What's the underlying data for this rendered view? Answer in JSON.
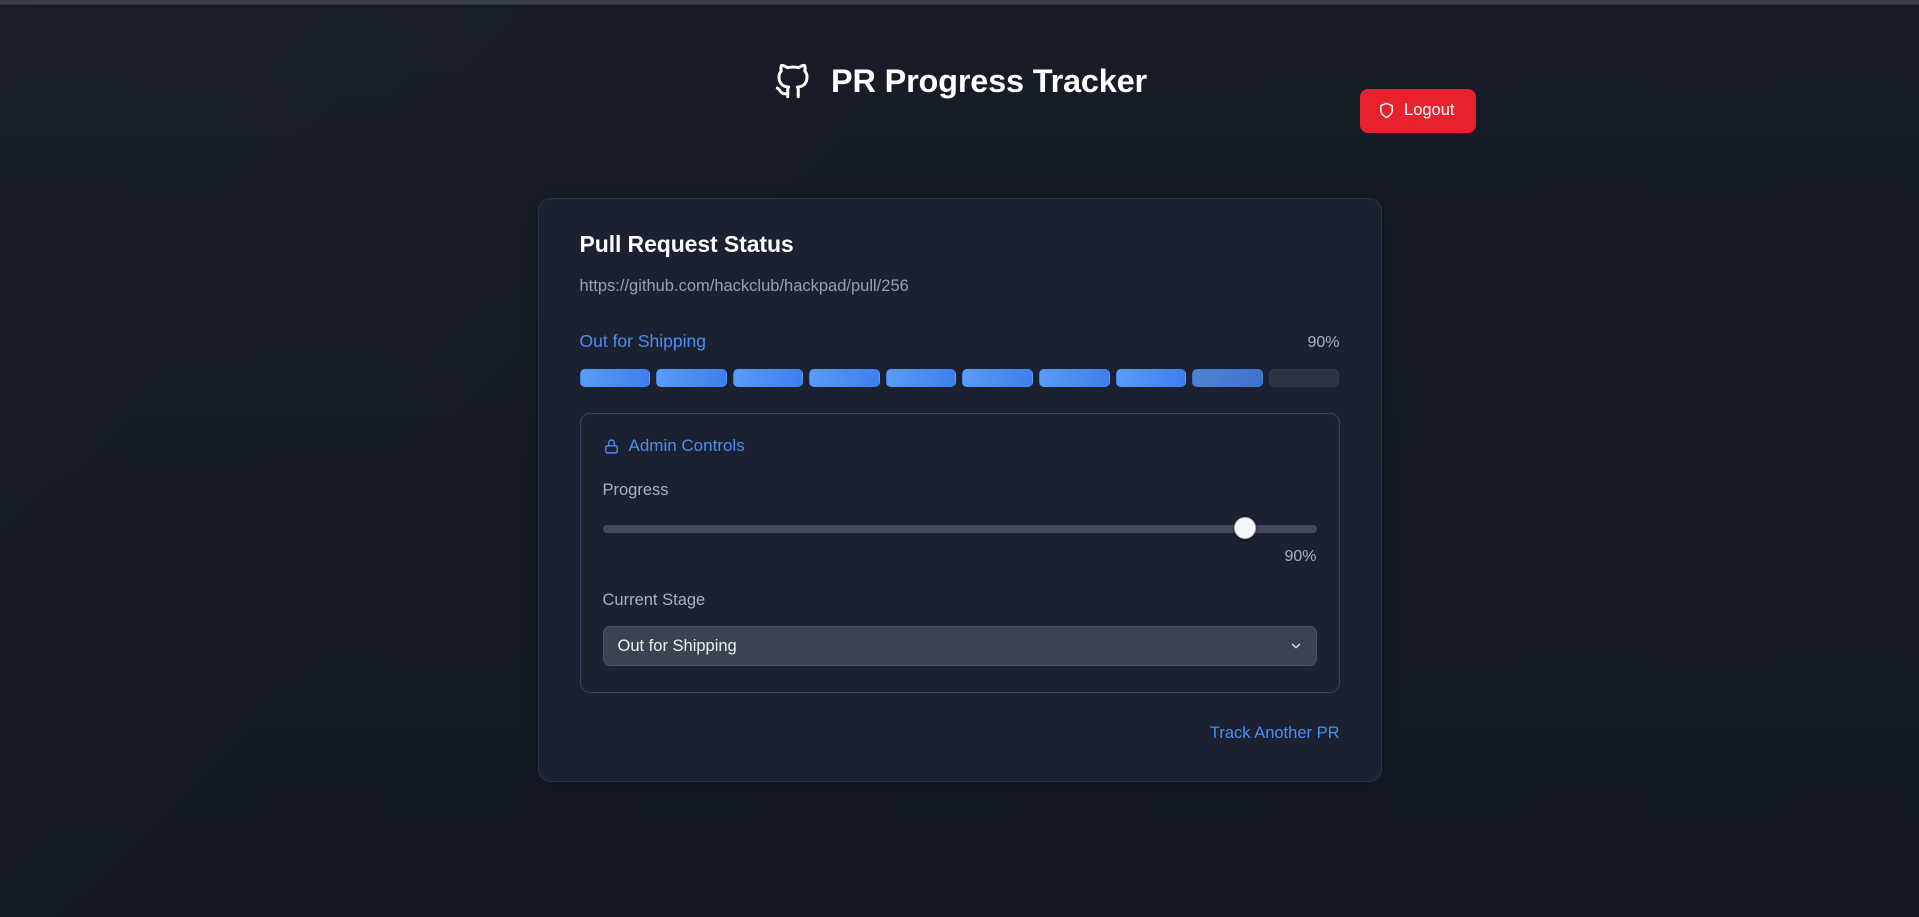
{
  "header": {
    "logo_icon": "github-icon",
    "title": "PR Progress Tracker",
    "logout": {
      "label": "Logout",
      "icon": "shield-icon",
      "color": "#e8222c"
    }
  },
  "card": {
    "title": "Pull Request Status",
    "pr_url": "https://github.com/hackclub/hackpad/pull/256",
    "stage_label": "Out for Shipping",
    "percent_label": "90%",
    "progress": {
      "percent": 90,
      "total_segments": 10,
      "filled_segments": 8,
      "partial_segments": 1,
      "empty_segments": 2,
      "fill_color": "#4a8ef0",
      "empty_color": "#2b3242"
    },
    "admin": {
      "title": "Admin Controls",
      "icon": "lock-icon",
      "accent_color": "#4a8ef0",
      "progress_label": "Progress",
      "slider": {
        "value": 90,
        "min": 0,
        "max": 100,
        "value_label": "90%"
      },
      "stage_label": "Current Stage",
      "stage_select": {
        "value": "Out for Shipping",
        "chevron_icon": "chevron-down-icon"
      }
    },
    "footer_link": "Track Another PR"
  }
}
